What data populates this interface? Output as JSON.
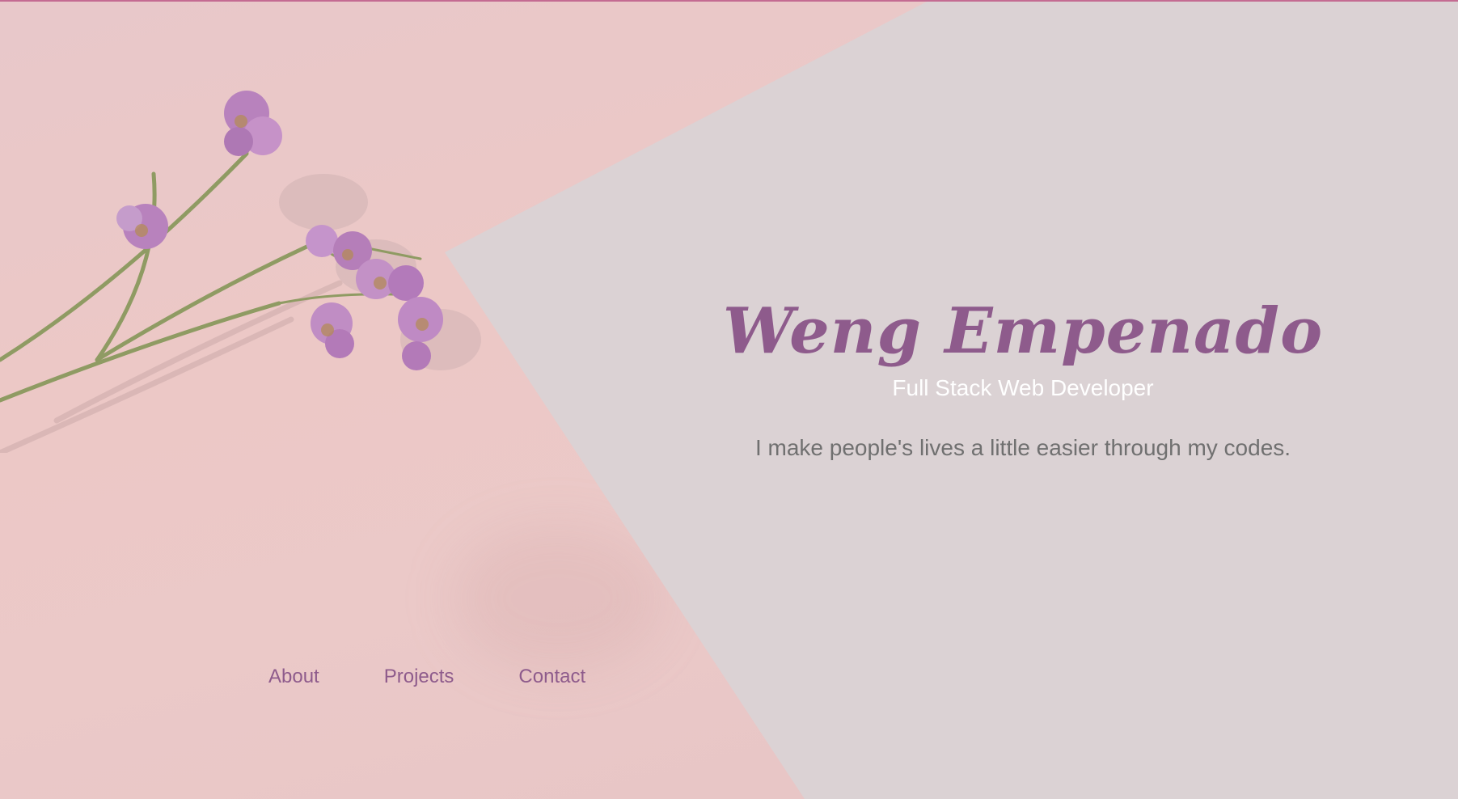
{
  "hero": {
    "name": "Weng Empenado",
    "role": "Full Stack Web Developer",
    "tagline": "I make people's lives a little easier through my codes."
  },
  "nav": {
    "items": [
      {
        "label": "About"
      },
      {
        "label": "Projects"
      },
      {
        "label": "Contact"
      }
    ]
  },
  "colors": {
    "accent": "#8e5b8c",
    "background_left": "#ebc9c8",
    "background_right": "#dbd2d4",
    "tagline": "#707070",
    "role": "#ffffff"
  },
  "icons": [
    "flower-illustration"
  ]
}
